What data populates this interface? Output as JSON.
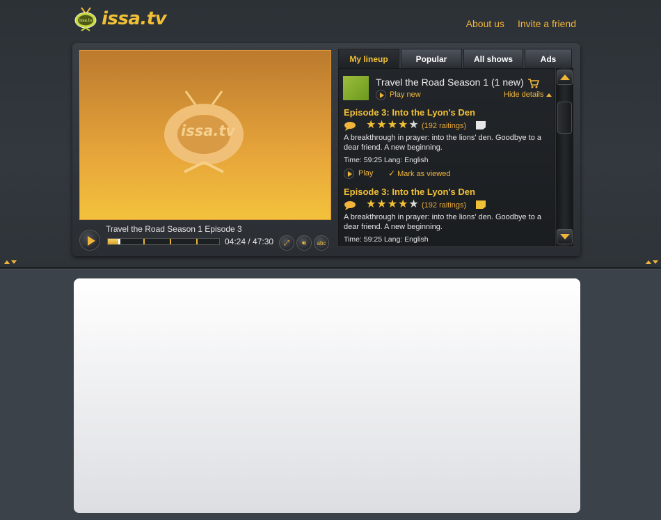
{
  "site": {
    "logo_text": "issa.tv"
  },
  "nav": {
    "about": "About us",
    "invite": "Invite a friend"
  },
  "player": {
    "video_logo_text": "issa.tv",
    "now_playing": "Travel the Road Season 1 Episode 3",
    "time": "04:24 / 47:30",
    "progress_fraction": 0.093,
    "subtitle_label": "abc"
  },
  "tabs": [
    {
      "label": "My lineup",
      "active": true
    },
    {
      "label": "Popular"
    },
    {
      "label": "All shows"
    },
    {
      "label": "Ads"
    }
  ],
  "lineup": {
    "show_title": "Travel the Road Season 1 (1 new)",
    "play_new": "Play new",
    "hide_details": "Hide details",
    "episodes": [
      {
        "title": "Episode 3: Into the Lyon's Den",
        "rating_stars": 4,
        "ratings": "(192 raitings)",
        "description": "A breakthrough in prayer: into the lions' den. Goodbye to a dear friend. A new beginning.",
        "meta": "Time: 59:25   Lang: English",
        "play": "Play",
        "mark_viewed": "Mark as viewed",
        "note_color": "#e6e6e6"
      },
      {
        "title": "Episode 3: Into the Lyon's Den",
        "rating_stars": 4,
        "ratings": "(192 raitings)",
        "description": "A breakthrough in prayer: into the lions' den. Goodbye to a dear friend. A new beginning.",
        "meta": "Time: 59:25   Lang: English",
        "note_color": "#f2c036"
      }
    ]
  },
  "colors": {
    "accent": "#f2b53c",
    "background": "#3b4249",
    "video": "#e6a43a"
  }
}
